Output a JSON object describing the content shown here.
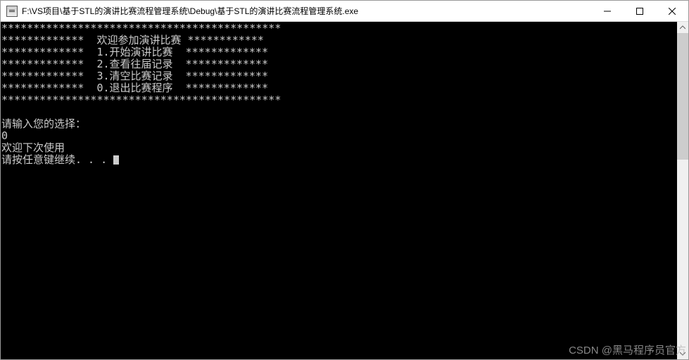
{
  "window": {
    "title": "F:\\VS项目\\基于STL的演讲比赛流程管理系统\\Debug\\基于STL的演讲比赛流程管理系统.exe"
  },
  "console": {
    "line_top": "********************************************",
    "menu_header": "*************  欢迎参加演讲比赛 ************",
    "menu_item_1": "*************  1.开始演讲比赛  *************",
    "menu_item_2": "*************  2.查看往届记录  *************",
    "menu_item_3": "*************  3.清空比赛记录  *************",
    "menu_item_0": "*************  0.退出比赛程序  *************",
    "line_bottom": "********************************************",
    "blank": "",
    "prompt": "请输入您的选择：",
    "input_value": "0",
    "goodbye": "欢迎下次使用",
    "continue": "请按任意键继续. . . "
  },
  "watermark": "CSDN @黑马程序员官方"
}
